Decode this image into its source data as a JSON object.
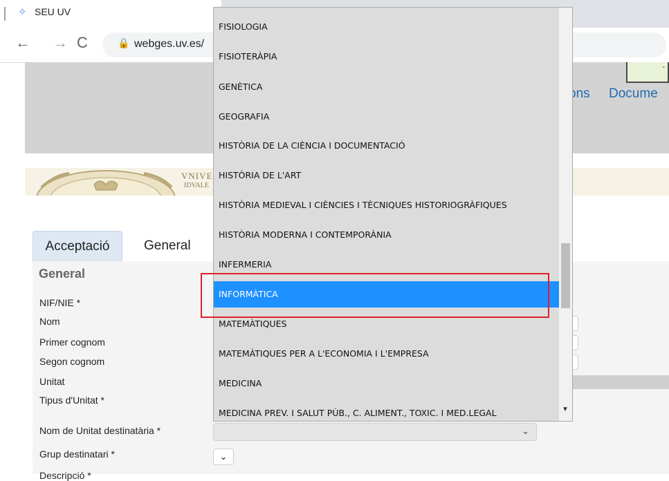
{
  "browser": {
    "tab_title": "SEU UV",
    "url": "webges.uv.es/",
    "back_glyph": "←",
    "forward_glyph": "→",
    "reload_glyph": "C",
    "lock_glyph": "🔒",
    "tab_icon_glyph": "✧"
  },
  "header": {
    "nav_partial_left": "ons",
    "nav_partial_right": "Docume",
    "university_line1": "VNIVER",
    "university_line2": "IDVALE"
  },
  "tabs": [
    {
      "label": "Acceptació",
      "active": false
    },
    {
      "label": "General",
      "active": true
    }
  ],
  "form": {
    "section_title": "General",
    "labels": {
      "nif": "NIF/NIE *",
      "nom": "Nom",
      "primer_cognom": "Primer cognom",
      "segon_cognom": "Segon cognom",
      "unitat": "Unitat",
      "tipus_unitat": "Tipus d'Unitat *",
      "nom_unitat": "Nom de Unitat destinatària *",
      "grup": "Grup destinatari *",
      "descripcio": "Descripció *"
    },
    "select_chevron": "⌄"
  },
  "dropdown": {
    "selected_index": 9,
    "options": [
      "FISIOLOGIA",
      "FISIOTERÀPIA",
      "GENÈTICA",
      "GEOGRAFIA",
      "HISTÒRIA DE LA CIÈNCIA I DOCUMENTACIÓ",
      "HISTÒRIA DE L'ART",
      "HISTÒRIA MEDIEVAL I CIÈNCIES I TÈCNIQUES HISTORIOGRÀFIQUES",
      "HISTÒRIA MODERNA I CONTEMPORÀNIA",
      "INFERMERIA",
      "INFORMÀTICA",
      "MATEMÀTIQUES",
      "MATEMÀTIQUES PER A L'ECONOMIA I L'EMPRESA",
      "MEDICINA",
      "MEDICINA PREV. I SALUT PÚB., C. ALIMENT., TOXIC. I MED.LEGAL"
    ]
  },
  "colors": {
    "selected_option": "#1e90ff",
    "highlight_box": "#e0202a",
    "header_gray": "#d3d3d3",
    "link_blue": "#1f6cb0"
  }
}
